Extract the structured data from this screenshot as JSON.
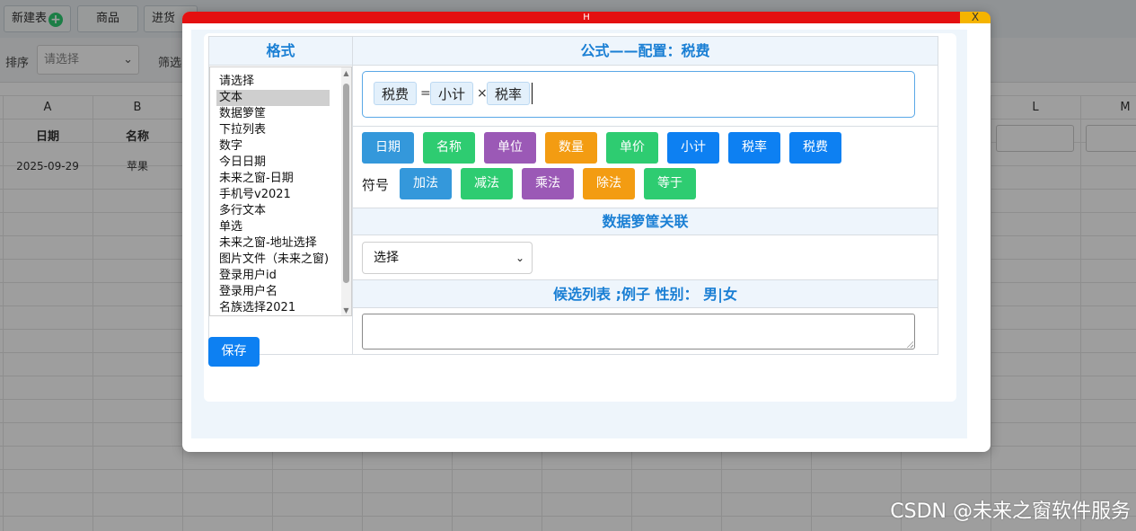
{
  "background": {
    "toolbar_buttons": [
      "新建表",
      "商品",
      "进货"
    ],
    "sort_label": "排序",
    "sort_placeholder": "请选择",
    "filter_label": "筛选",
    "columns": [
      "A",
      "B",
      "L",
      "M"
    ],
    "headers": [
      "日期",
      "名称"
    ],
    "row1": [
      "2025-09-29",
      "苹果"
    ]
  },
  "modal": {
    "title_bar": "H",
    "close_label": "X",
    "format_header": "格式",
    "formula_header": "公式——配置：税费",
    "format_options": [
      "请选择",
      "文本",
      "数据箩筐",
      "下拉列表",
      "数字",
      "今日日期",
      "未来之窗-日期",
      "手机号v2021",
      "多行文本",
      "单选",
      "未来之窗-地址选择",
      "图片文件（未来之窗)",
      "登录用户id",
      "登录用户名",
      "名族选择2021"
    ],
    "selected_format": "文本",
    "formula_tokens": [
      "税费",
      "=",
      "小计",
      "×",
      "税率"
    ],
    "field_buttons": [
      "日期",
      "名称",
      "单位",
      "数量",
      "单价",
      "小计",
      "税率",
      "税费"
    ],
    "symbol_label": "符号",
    "symbol_buttons": [
      "加法",
      "减法",
      "乘法",
      "除法",
      "等于"
    ],
    "basket_header": "数据箩筐关联",
    "basket_select_value": "选择",
    "candidate_header": "候选列表 ;例子 性别： 男|女",
    "save_label": "保存"
  },
  "colors": {
    "title_bar": "#e41010",
    "accent_blue": "#0d80f2",
    "field_colors": [
      "#3498db",
      "#2ecc71",
      "#9b59b6",
      "#f39c12",
      "#2ecc71",
      "#0d80f2",
      "#0d80f2",
      "#0d80f2"
    ],
    "symbol_colors": [
      "#3498db",
      "#2ecc71",
      "#9b59b6",
      "#f39c12",
      "#2ecc71"
    ]
  },
  "watermark": "CSDN @未来之窗软件服务"
}
